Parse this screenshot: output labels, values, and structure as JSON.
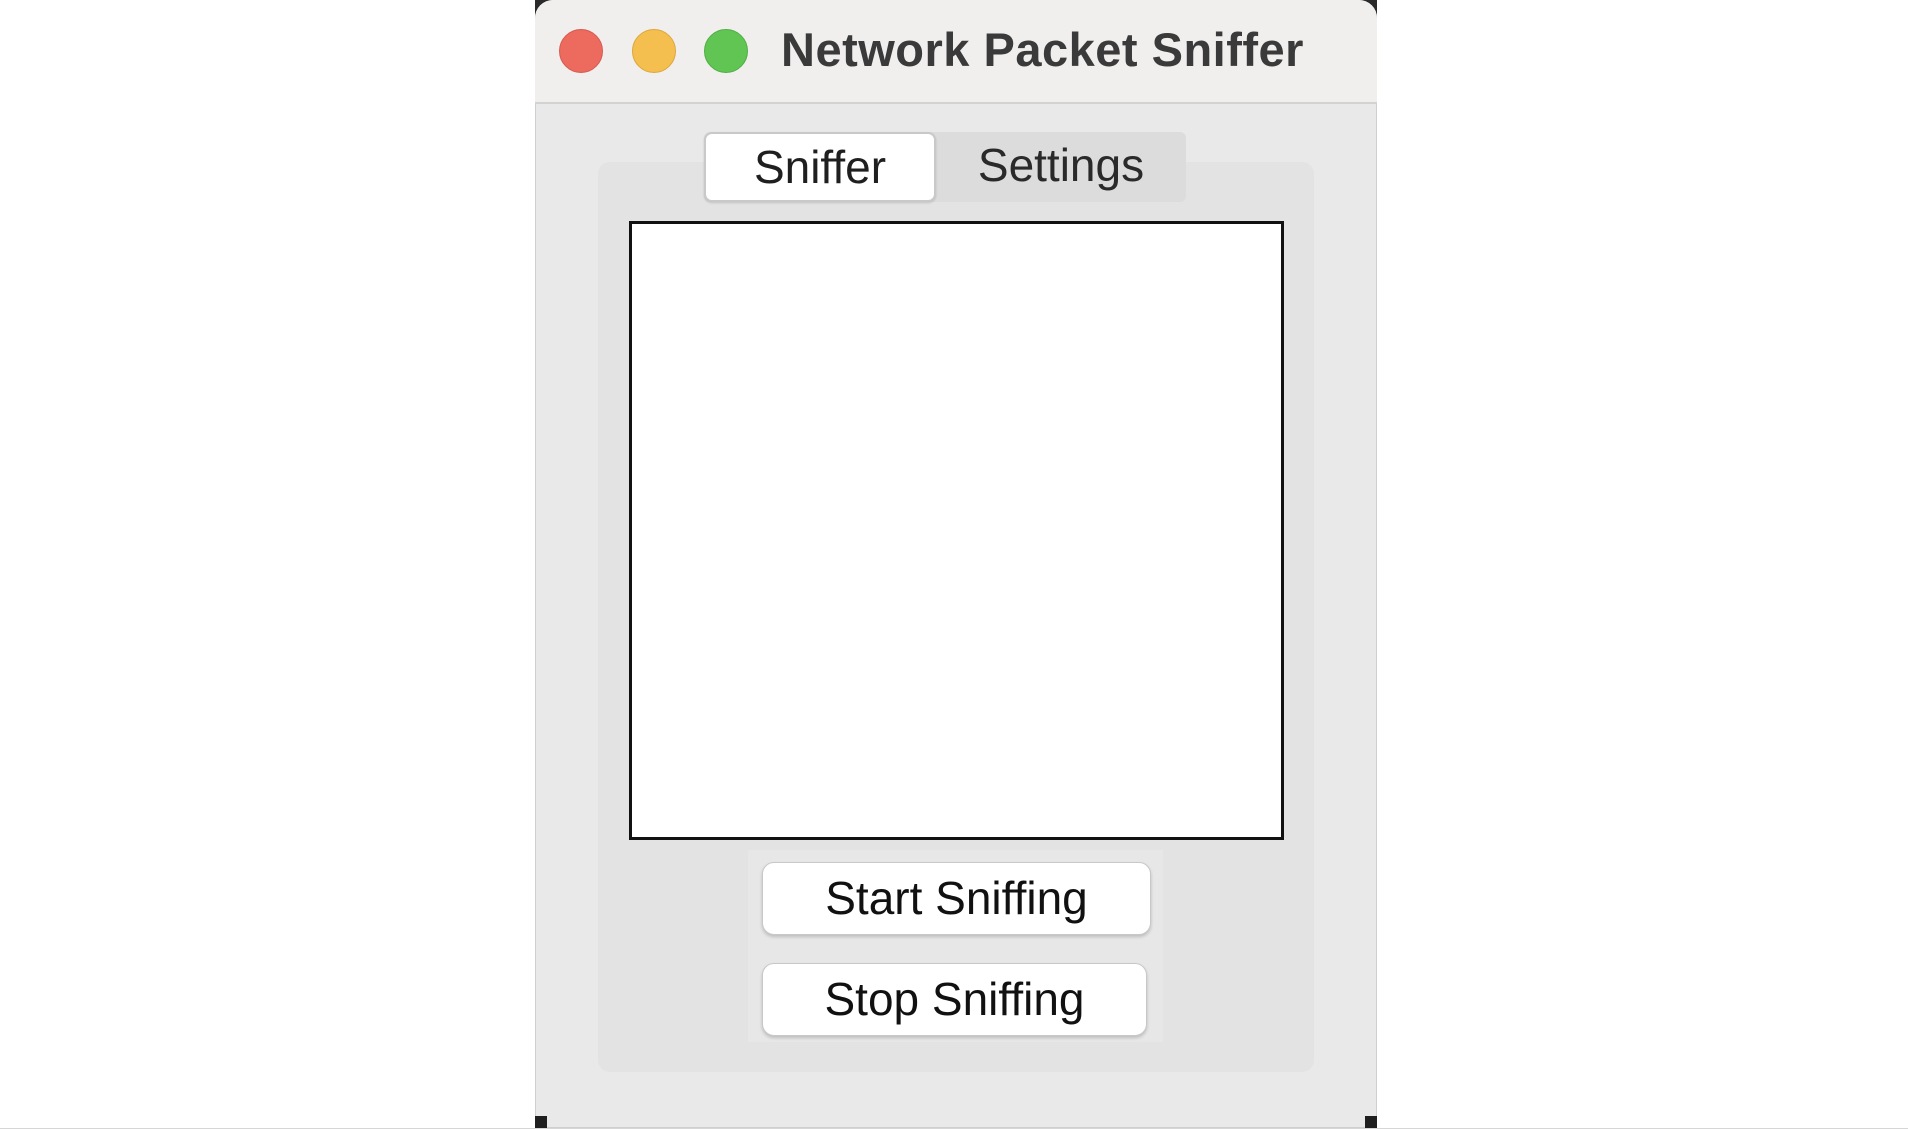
{
  "window": {
    "title": "Network Packet Sniffer"
  },
  "tabs": [
    {
      "label": "Sniffer",
      "selected": true
    },
    {
      "label": "Settings",
      "selected": false
    }
  ],
  "output": {
    "text": ""
  },
  "buttons": {
    "start_label": "Start Sniffing",
    "stop_label": "Stop Sniffing"
  },
  "colors": {
    "close": "#ec6a5e",
    "minimize": "#f4bf4f",
    "maximize": "#61c554"
  }
}
